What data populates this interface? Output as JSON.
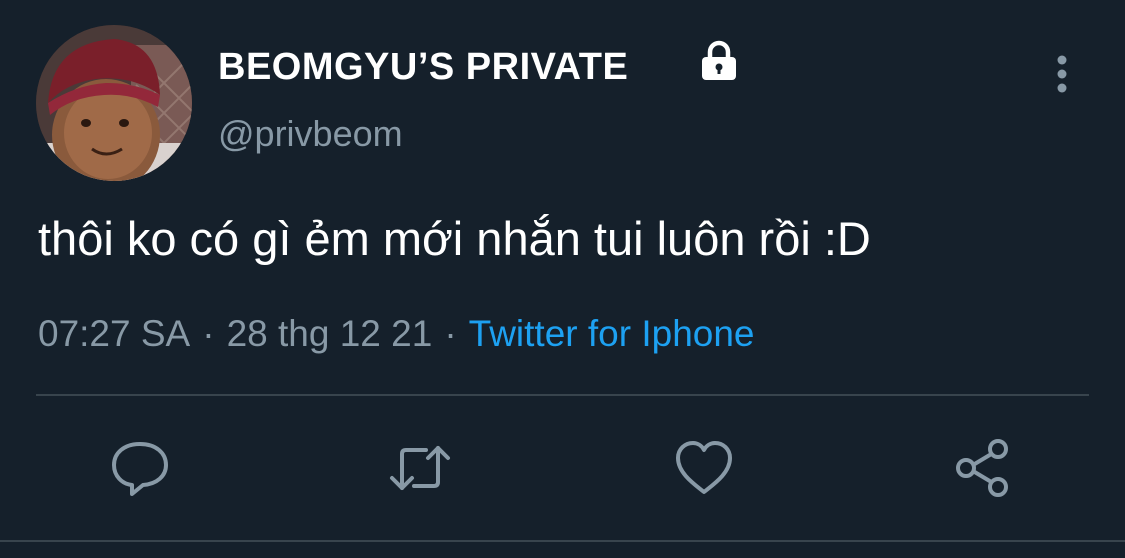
{
  "tweet": {
    "display_name": "BEOMGYU’S PRIVATE",
    "handle": "@privbeom",
    "text": "thôi ko có gì ẻm mới nhắn tui luôn rồi :D",
    "time": "07:27 SA",
    "separator": "·",
    "date": "28 thg 12 21",
    "source": "Twitter for Iphone",
    "protected_icon": "lock-icon"
  },
  "actions": {
    "icons": [
      "reply-icon",
      "retweet-icon",
      "like-icon",
      "share-icon"
    ]
  },
  "colors": {
    "background": "#15202b",
    "text_primary": "#ffffff",
    "text_secondary": "#8899a6",
    "accent": "#1da1f2",
    "divider": "#38444d"
  }
}
